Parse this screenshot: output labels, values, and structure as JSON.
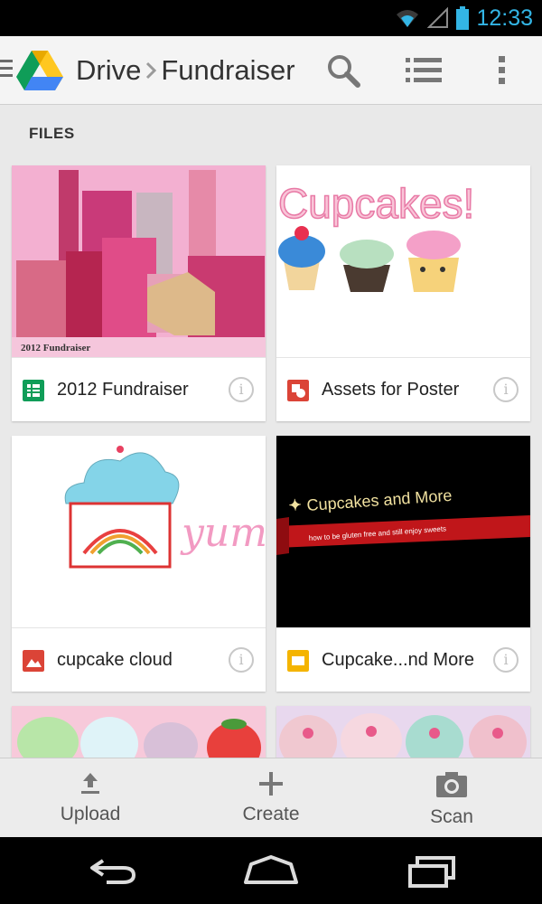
{
  "status_bar": {
    "time": "12:33",
    "icons": [
      "wifi-icon",
      "signal-icon",
      "battery-icon"
    ],
    "time_color": "#33b5e5"
  },
  "action_bar": {
    "app_name": "Drive",
    "folder": "Fundraiser",
    "icons": [
      "menu-icon",
      "drive-logo",
      "search-icon",
      "list-view-icon",
      "overflow-icon"
    ]
  },
  "section_title": "FILES",
  "files": [
    {
      "name": "2012 Fundraiser",
      "type": "spreadsheet",
      "type_color": "#0f9d58",
      "thumb_caption": "2012 Fundraiser"
    },
    {
      "name": "Assets for Poster",
      "type": "drawing",
      "type_color": "#db4437",
      "thumb_caption": "Cupcakes!"
    },
    {
      "name": "cupcake cloud",
      "type": "image",
      "type_color": "#db4437",
      "thumb_caption": "yum!"
    },
    {
      "name": "Cupcake...nd More",
      "type": "presentation",
      "type_color": "#f4b400",
      "thumb_caption": "Cupcakes and More",
      "thumb_subcaption": "how to be gluten free and still enjoy sweets"
    },
    {
      "name": "",
      "type": "image",
      "type_color": "#db4437"
    },
    {
      "name": "",
      "type": "image",
      "type_color": "#db4437"
    }
  ],
  "bottom_bar": {
    "upload": "Upload",
    "create": "Create",
    "scan": "Scan"
  },
  "nav_bar": [
    "back-icon",
    "home-icon",
    "recents-icon"
  ]
}
